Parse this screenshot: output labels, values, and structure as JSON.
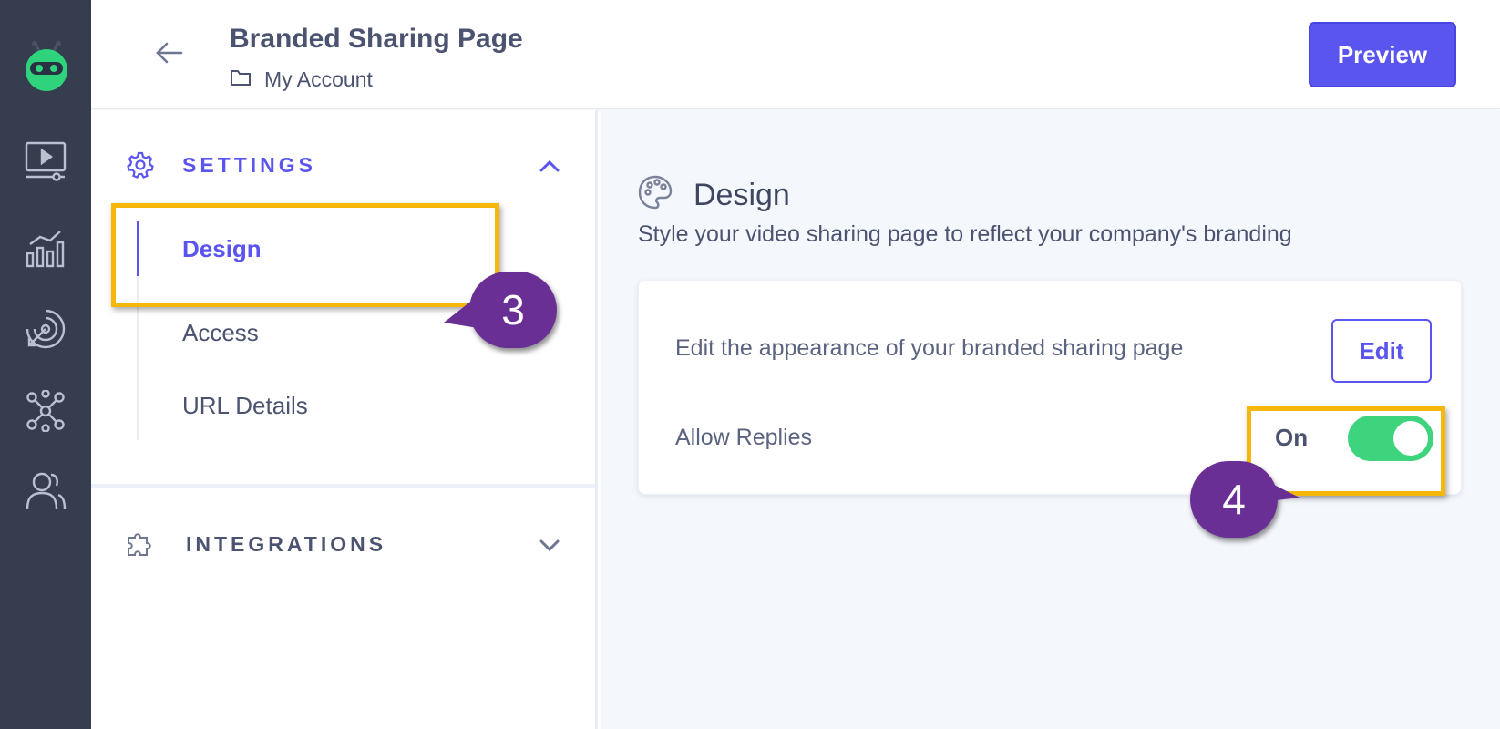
{
  "header": {
    "title": "Branded Sharing Page",
    "breadcrumb": "My Account",
    "preview_label": "Preview"
  },
  "rail": {
    "items": [
      "logo-icon",
      "video-library-icon",
      "analytics-icon",
      "target-icon",
      "integrations-hub-icon",
      "team-icon"
    ]
  },
  "sidebar": {
    "settings_label": "SETTINGS",
    "items": [
      {
        "label": "Design",
        "active": true
      },
      {
        "label": "Access",
        "active": false
      },
      {
        "label": "URL Details",
        "active": false
      }
    ],
    "integrations_label": "INTEGRATIONS"
  },
  "main": {
    "title": "Design",
    "subtitle": "Style your video sharing page to reflect your company's branding",
    "edit_text": "Edit the appearance of your branded sharing page",
    "edit_label": "Edit",
    "allow_replies_label": "Allow Replies",
    "toggle_state": "On"
  },
  "annotations": {
    "step_a": "3",
    "step_b": "4",
    "highlight_color": "#f5b80a",
    "marker_color": "#6a2f95"
  },
  "colors": {
    "accent": "#5b55f0",
    "toggle_on": "#3ed47e",
    "rail_bg": "#353d4f"
  }
}
